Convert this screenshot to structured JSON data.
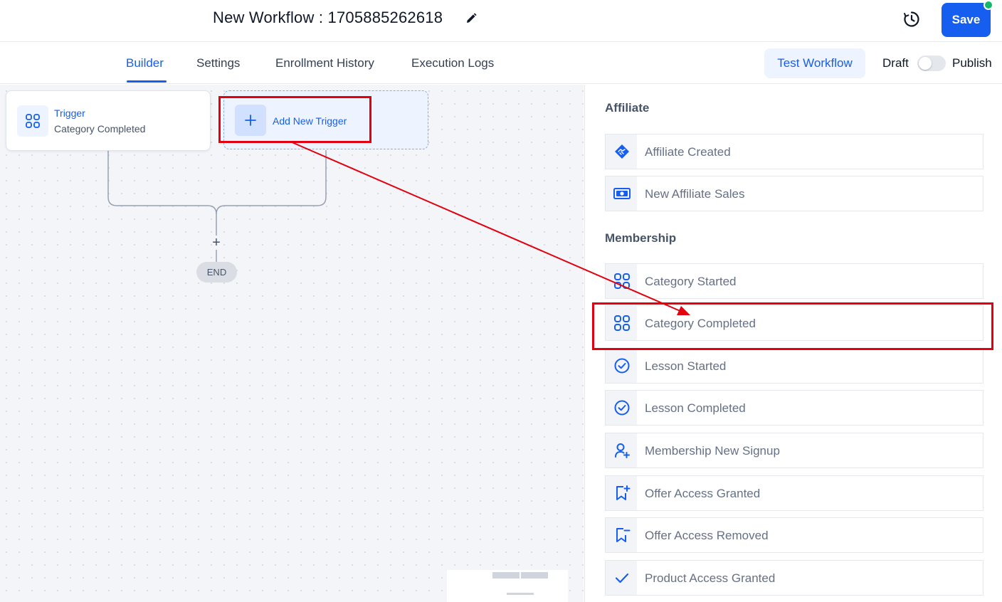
{
  "header": {
    "title": "New Workflow : 1705885262618",
    "save_label": "Save"
  },
  "tabs": [
    {
      "label": "Builder",
      "active": true
    },
    {
      "label": "Settings",
      "active": false
    },
    {
      "label": "Enrollment History",
      "active": false
    },
    {
      "label": "Execution Logs",
      "active": false
    }
  ],
  "toolbar": {
    "test_workflow_label": "Test Workflow",
    "draft_label": "Draft",
    "publish_label": "Publish",
    "published": false
  },
  "canvas": {
    "trigger_card": {
      "title": "Trigger",
      "subtitle": "Category Completed",
      "icon": "grid-icon"
    },
    "add_trigger_label": "Add New Trigger",
    "end_label": "END"
  },
  "panel": {
    "sections": [
      {
        "title": "Affiliate",
        "items": [
          {
            "label": "Affiliate Created",
            "icon": "handshake-icon"
          },
          {
            "label": "New Affiliate Sales",
            "icon": "money-icon"
          }
        ]
      },
      {
        "title": "Membership",
        "items": [
          {
            "label": "Category Started",
            "icon": "grid-icon"
          },
          {
            "label": "Category Completed",
            "icon": "grid-icon"
          },
          {
            "label": "Lesson Started",
            "icon": "check-circle-icon"
          },
          {
            "label": "Lesson Completed",
            "icon": "check-circle-icon"
          },
          {
            "label": "Membership New Signup",
            "icon": "user-plus-icon"
          },
          {
            "label": "Offer Access Granted",
            "icon": "bookmark-plus-icon"
          },
          {
            "label": "Offer Access Removed",
            "icon": "bookmark-minus-icon"
          },
          {
            "label": "Product Access Granted",
            "icon": "check-icon"
          }
        ]
      }
    ]
  },
  "colors": {
    "accent": "#155eef",
    "annotation": "#e3000f",
    "status_dot": "#12b76a"
  }
}
